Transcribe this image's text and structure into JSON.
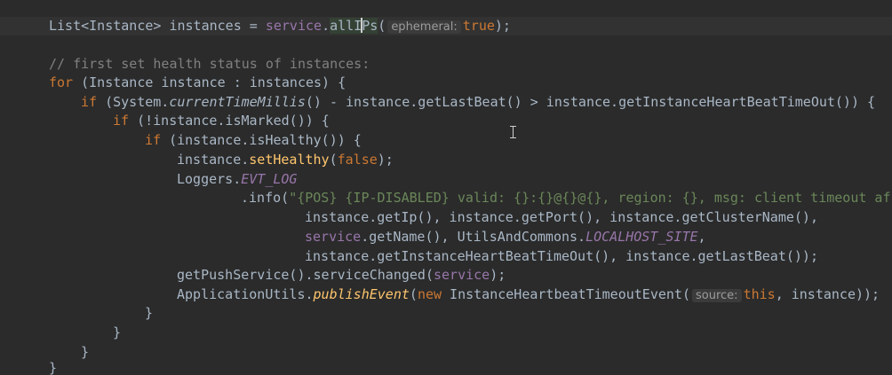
{
  "editor": {
    "line1": {
      "a": "List<Instance> instances = ",
      "svc": "service",
      "dot": ".",
      "m1": "allI",
      "m2": "Ps",
      "paren_open": "(",
      "hint_label": "ephemeral:",
      "kw_true": "true",
      "end": ");"
    },
    "comment": "// first set health status of instances:",
    "line_for": {
      "kw": "for",
      "rest": " (Instance instance : instances) {"
    },
    "line_if1": {
      "kw": "if",
      "a": " (System.",
      "m": "currentTimeMillis",
      "b": "() - instance.getLastBeat() > instance.getInstanceHeartBeatTimeOut()) {"
    },
    "line_if2": {
      "kw": "if",
      "rest": " (!instance.isMarked()) {"
    },
    "line_if3": {
      "kw": "if",
      "rest": " (instance.isHealthy()) {"
    },
    "line_sethealthy": {
      "a": "instance.",
      "m": "setHealthy",
      "b": "(",
      "kw": "false",
      "c": ");"
    },
    "line_loggers": {
      "a": "Loggers.",
      "const": "EVT_LOG"
    },
    "line_info": {
      "a": ".info(",
      "str": "\"{POS} {IP-DISABLED} valid: {}:{}@{}@{}, region: {}, msg: client timeout af"
    },
    "line_args1": "instance.getIp(), instance.getPort(), instance.getClusterName(),",
    "line_args2": {
      "svc": "service",
      "a": ".getName(), UtilsAndCommons.",
      "const": "LOCALHOST_SITE",
      "b": ","
    },
    "line_args3": "instance.getInstanceHeartBeatTimeOut(), instance.getLastBeat());",
    "line_push": {
      "a": "getPushService().serviceChanged(",
      "svc": "service",
      "b": ");"
    },
    "line_publish": {
      "a": "ApplicationUtils.",
      "m": "publishEvent",
      "b": "(",
      "kw_new": "new",
      "c": " InstanceHeartbeatTimeoutEvent(",
      "hint_label": "source:",
      "kw_this": "this",
      "d": ", instance));"
    },
    "brace": "}"
  }
}
